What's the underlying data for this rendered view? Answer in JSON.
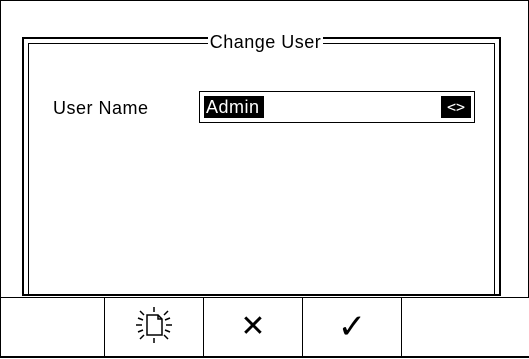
{
  "dialog": {
    "title": "Change User",
    "user_name_label": "User Name",
    "user_name_value": "Admin",
    "toggle_label": "<>"
  },
  "softkeys": {
    "blank_left": "",
    "new_document_icon": "new-document-icon",
    "cancel_glyph": "✕",
    "confirm_glyph": "✓",
    "blank_right": ""
  }
}
